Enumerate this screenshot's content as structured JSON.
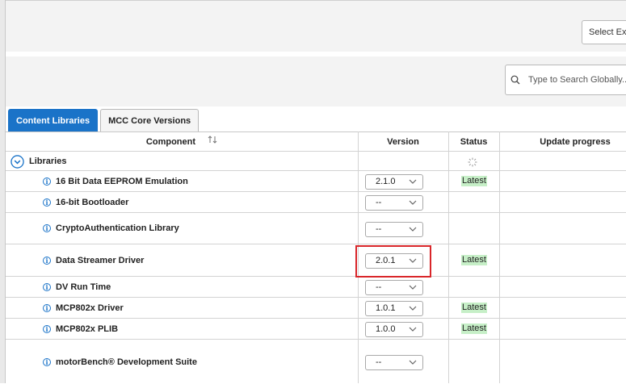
{
  "toolbar": {
    "select_label": "Select Exp"
  },
  "search": {
    "placeholder": "Type to Search Globally..."
  },
  "tabs": [
    {
      "label": "Content Libraries",
      "active": true
    },
    {
      "label": "MCC Core Versions",
      "active": false
    }
  ],
  "table": {
    "columns": [
      "Component",
      "Version",
      "Status",
      "Update progress"
    ],
    "group": {
      "label": "Libraries"
    },
    "rows": [
      {
        "name": "16 Bit Data EEPROM Emulation",
        "version": "2.1.0",
        "status": "Latest"
      },
      {
        "name": "16-bit Bootloader",
        "version": "--",
        "status": ""
      },
      {
        "name": "CryptoAuthentication Library",
        "version": "--",
        "status": ""
      },
      {
        "name": "Data Streamer Driver",
        "version": "2.0.1",
        "status": "Latest"
      },
      {
        "name": "DV Run Time",
        "version": "--",
        "status": ""
      },
      {
        "name": "MCP802x Driver",
        "version": "1.0.1",
        "status": "Latest"
      },
      {
        "name": "MCP802x PLIB",
        "version": "1.0.0",
        "status": "Latest"
      },
      {
        "name": "motorBench® Development Suite",
        "version": "--",
        "status": ""
      }
    ]
  },
  "colors": {
    "accent": "#1a73c8",
    "highlight": "#d9262a",
    "latest_bg": "#c6efc7"
  }
}
